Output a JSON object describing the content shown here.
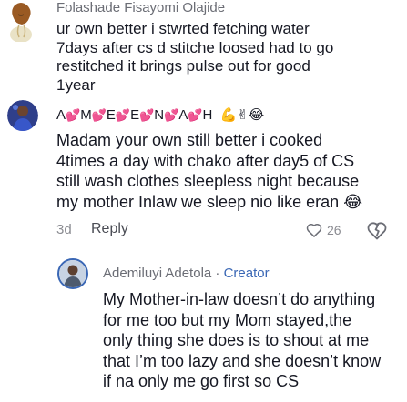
{
  "comment1": {
    "author": "Folashade Fisayomi Olajide",
    "text": "ur own better i stwrted fetching water\n7days after cs d stitche loosed had to go\nrestitched it brings pulse out for good\n1year"
  },
  "comment2": {
    "author_letters": [
      "A",
      "M",
      "E",
      "E",
      "N",
      "A",
      "H"
    ],
    "author_emoji": "💪✌😂",
    "text": "Madam your own still better i cooked\n4times a day with chako after day5 of CS\nstill wash clothes sleepless night because\nmy mother Inlaw we sleep nio like eran 😂",
    "time": "3d",
    "reply_label": "Reply",
    "like_count": "26"
  },
  "reply1": {
    "author": "Ademiluyi Adetola",
    "separator": " · ",
    "badge": "Creator",
    "text": "My Mother-in-law doesn’t do anything\nfor me too but my Mom stayed,the\nonly thing she does is to shout at me\nthat I’m too lazy and she doesn’t know\nif na only me go first so CS"
  },
  "colors": {
    "heart": "#fe2c55",
    "creator": "#3a67b5",
    "muted": "#8a8b91"
  },
  "icons": [
    "heart-outline-icon",
    "dislike-icon"
  ]
}
